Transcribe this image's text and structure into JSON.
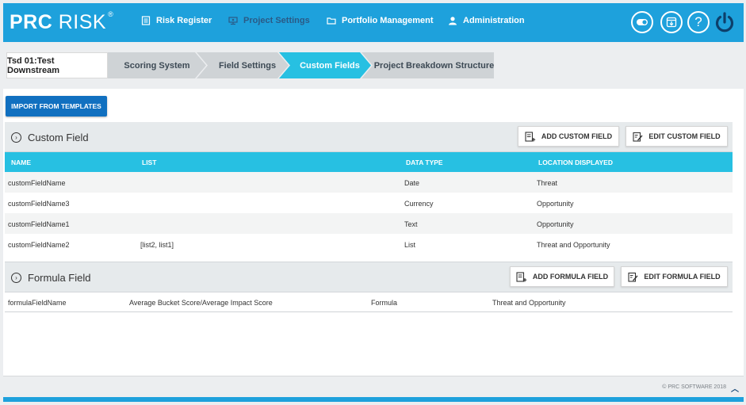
{
  "header": {
    "logo_main": "PRC",
    "logo_sub": "RISK",
    "logo_mark": "®",
    "nav": [
      {
        "label": "Risk Register",
        "icon": "list-icon"
      },
      {
        "label": "Project Settings",
        "icon": "settings-icon"
      },
      {
        "label": "Portfolio Management",
        "icon": "folder-icon"
      },
      {
        "label": "Administration",
        "icon": "user-icon"
      }
    ],
    "active_nav": "Project Settings",
    "right_icons": [
      "toggle-icon",
      "download-icon",
      "help-icon",
      "power-icon"
    ],
    "help_glyph": "?",
    "colors": {
      "bar": "#1ea1dc",
      "active_nav": "#2b5a86",
      "accent": "#27c0e2",
      "button": "#1170c0"
    }
  },
  "breadcrumb": {
    "project": "Tsd 01:Test Downstream",
    "steps": [
      "Scoring System",
      "Field Settings",
      "Custom Fields",
      "Project Breakdown Structure"
    ],
    "active": "Custom Fields"
  },
  "actions": {
    "import_label": "IMPORT FROM TEMPLATES"
  },
  "custom_panel": {
    "title": "Custom Field",
    "add_label": "ADD CUSTOM FIELD",
    "edit_label": "EDIT CUSTOM FIELD",
    "columns": [
      "NAME",
      "LIST",
      "DATA TYPE",
      "LOCATION DISPLAYED"
    ],
    "rows": [
      {
        "name": "customFieldName",
        "list": "",
        "type": "Date",
        "location": "Threat"
      },
      {
        "name": "customFieldName3",
        "list": "",
        "type": "Currency",
        "location": "Opportunity"
      },
      {
        "name": "customFieldName1",
        "list": "",
        "type": "Text",
        "location": "Opportunity"
      },
      {
        "name": "customFieldName2",
        "list": "[list2, list1]",
        "type": "List",
        "location": "Threat and Opportunity"
      }
    ]
  },
  "formula_panel": {
    "title": "Formula Field",
    "add_label": "ADD FORMULA FIELD",
    "edit_label": "EDIT FORMULA FIELD",
    "rows": [
      {
        "name": "formulaFieldName",
        "expression": "Average Bucket Score/Average Impact Score",
        "type": "Formula",
        "location": "Threat and Opportunity"
      }
    ]
  },
  "footer": {
    "copyright": "© PRC SOFTWARE 2018",
    "scroll_glyph": "︿"
  }
}
